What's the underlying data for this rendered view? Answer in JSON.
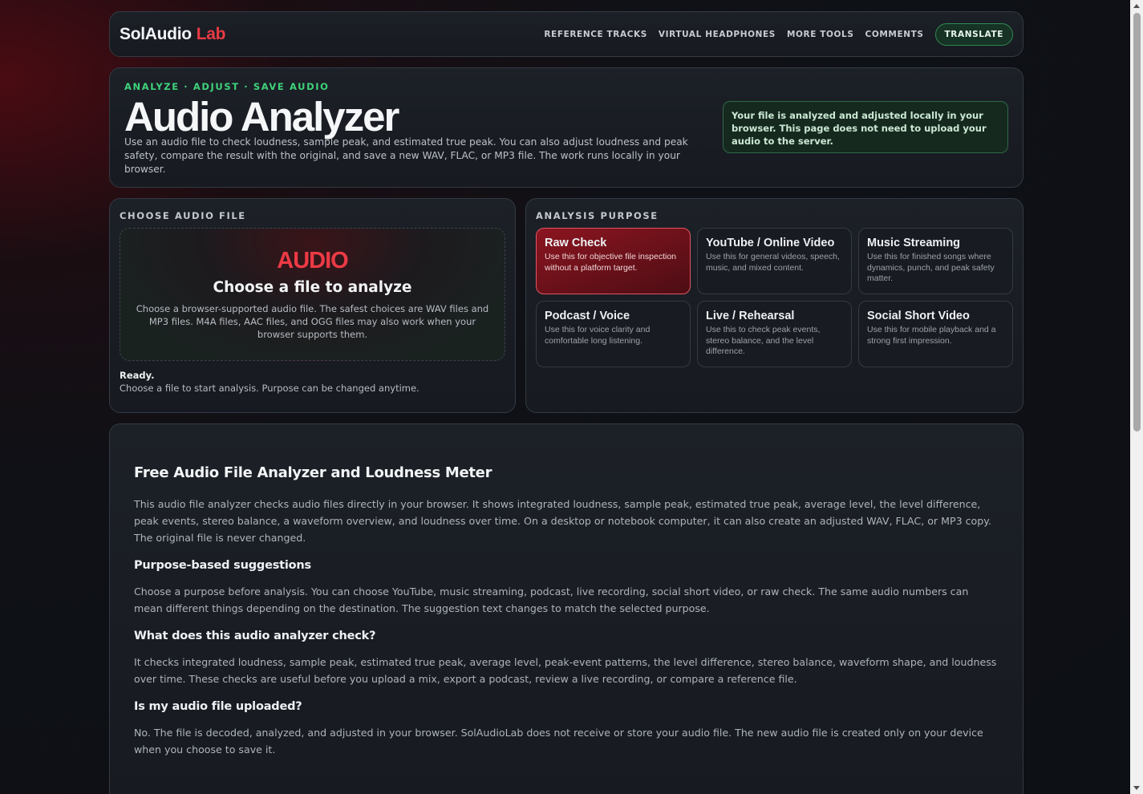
{
  "nav": {
    "brand": "SolAudio",
    "brand_accent": "Lab",
    "links": [
      "REFERENCE TRACKS",
      "VIRTUAL HEADPHONES",
      "MORE TOOLS",
      "COMMENTS"
    ],
    "translate_label": "TRANSLATE"
  },
  "hero": {
    "eyebrow": "ANALYZE · ADJUST · SAVE AUDIO",
    "title": "Audio Analyzer",
    "description": "Use an audio file to check loudness, sample peak, and estimated true peak. You can also adjust loudness and peak safety, compare the result with the original, and save a new WAV, FLAC, or MP3 file. The work runs locally in your browser.",
    "notice": "Your file is analyzed and adjusted locally in your browser. This page does not need to upload your audio to the server."
  },
  "upload": {
    "section_label": "CHOOSE AUDIO FILE",
    "badge": "AUDIO",
    "title": "Choose a file to analyze",
    "description": "Choose a browser-supported audio file. The safest choices are WAV files and MP3 files. M4A files, AAC files, and OGG files may also work when your browser supports them.",
    "status_title": "Ready.",
    "status_desc": "Choose a file to start analysis. Purpose can be changed anytime."
  },
  "purpose": {
    "section_label": "ANALYSIS PURPOSE",
    "options": [
      {
        "title": "Raw Check",
        "desc": "Use this for objective file inspection without a platform target."
      },
      {
        "title": "YouTube / Online Video",
        "desc": "Use this for general videos, speech, music, and mixed content."
      },
      {
        "title": "Music Streaming",
        "desc": "Use this for finished songs where dynamics, punch, and peak safety matter."
      },
      {
        "title": "Podcast / Voice",
        "desc": "Use this for voice clarity and comfortable long listening."
      },
      {
        "title": "Live / Rehearsal",
        "desc": "Use this to check peak events, stereo balance, and the level difference."
      },
      {
        "title": "Social Short Video",
        "desc": "Use this for mobile playback and a strong first impression."
      }
    ]
  },
  "article": {
    "h1": "Free Audio File Analyzer and Loudness Meter",
    "p1": "This audio file analyzer checks audio files directly in your browser. It shows integrated loudness, sample peak, estimated true peak, average level, the level difference, peak events, stereo balance, a waveform overview, and loudness over time. On a desktop or notebook computer, it can also create an adjusted WAV, FLAC, or MP3 copy. The original file is never changed.",
    "h2a": "Purpose-based suggestions",
    "p2": "Choose a purpose before analysis. You can choose YouTube, music streaming, podcast, live recording, social short video, or raw check. The same audio numbers can mean different things depending on the destination. The suggestion text changes to match the selected purpose.",
    "h2b": "What does this audio analyzer check?",
    "p3": "It checks integrated loudness, sample peak, estimated true peak, average level, peak-event patterns, the level difference, stereo balance, waveform shape, and loudness over time. These checks are useful before you upload a mix, export a podcast, review a live recording, or compare a reference file.",
    "h2c": "Is my audio file uploaded?",
    "p4": "No. The file is decoded, analyzed, and adjusted in your browser. SolAudioLab does not receive or store your audio file. The new audio file is created only on your device when you choose to save it."
  },
  "colors": {
    "accent_red": "#e83a44",
    "accent_green": "#3ed27a",
    "background": "#0f1116"
  }
}
